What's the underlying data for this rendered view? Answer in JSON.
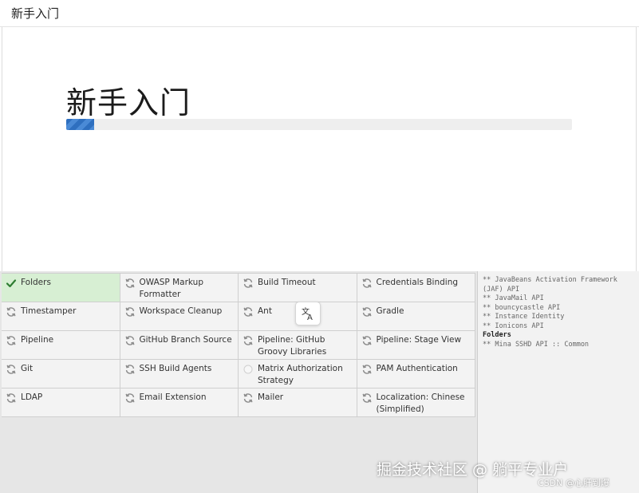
{
  "header": {
    "title": "新手入门"
  },
  "hero": {
    "title": "新手入门",
    "progress_fraction": 0.055
  },
  "plugins": [
    {
      "name": "Folders",
      "status": "success",
      "icon": "checkmark-icon"
    },
    {
      "name": "OWASP Markup Formatter",
      "status": "installing",
      "icon": "refresh-icon"
    },
    {
      "name": "Build Timeout",
      "status": "installing",
      "icon": "refresh-icon"
    },
    {
      "name": "Credentials Binding",
      "status": "installing",
      "icon": "refresh-icon"
    },
    {
      "name": "Timestamper",
      "status": "installing",
      "icon": "refresh-icon"
    },
    {
      "name": "Workspace Cleanup",
      "status": "installing",
      "icon": "refresh-icon"
    },
    {
      "name": "Ant",
      "status": "installing",
      "icon": "refresh-icon"
    },
    {
      "name": "Gradle",
      "status": "installing",
      "icon": "refresh-icon"
    },
    {
      "name": "Pipeline",
      "status": "installing",
      "icon": "refresh-icon"
    },
    {
      "name": "GitHub Branch Source",
      "status": "installing",
      "icon": "refresh-icon"
    },
    {
      "name": "Pipeline: GitHub Groovy Libraries",
      "status": "installing",
      "icon": "refresh-icon"
    },
    {
      "name": "Pipeline: Stage View",
      "status": "installing",
      "icon": "refresh-icon"
    },
    {
      "name": "Git",
      "status": "installing",
      "icon": "refresh-icon"
    },
    {
      "name": "SSH Build Agents",
      "status": "installing",
      "icon": "refresh-icon"
    },
    {
      "name": "Matrix Authorization Strategy",
      "status": "pending",
      "icon": "pending-circle-icon"
    },
    {
      "name": "PAM Authentication",
      "status": "installing",
      "icon": "refresh-icon"
    },
    {
      "name": "LDAP",
      "status": "installing",
      "icon": "refresh-icon"
    },
    {
      "name": "Email Extension",
      "status": "installing",
      "icon": "refresh-icon"
    },
    {
      "name": "Mailer",
      "status": "installing",
      "icon": "refresh-icon"
    },
    {
      "name": "Localization: Chinese (Simplified)",
      "status": "installing",
      "icon": "refresh-icon"
    }
  ],
  "log": [
    {
      "text": "** JavaBeans Activation Framework (JAF) API",
      "bold": false
    },
    {
      "text": "** JavaMail API",
      "bold": false
    },
    {
      "text": "** bouncycastle API",
      "bold": false
    },
    {
      "text": "** Instance Identity",
      "bold": false
    },
    {
      "text": "** Ionicons API",
      "bold": false
    },
    {
      "text": "Folders",
      "bold": true
    },
    {
      "text": "** Mina SSHD API :: Common",
      "bold": false
    }
  ],
  "colors": {
    "success": "#d7efd3",
    "check": "#2e7d32",
    "refresh": "#8a8a8a",
    "progress": "#2e6fbf"
  },
  "watermark": {
    "main": "掘金技术社区 @ 躺平专业户",
    "sub": "CSDN @心肝到爆"
  }
}
